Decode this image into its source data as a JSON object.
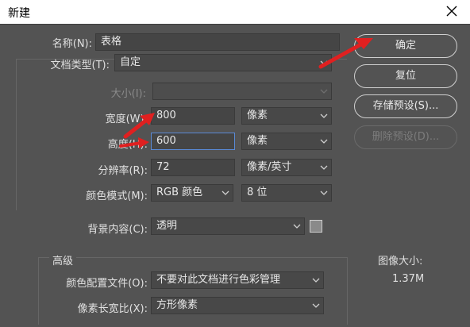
{
  "window": {
    "title": "新建"
  },
  "form": {
    "name": {
      "label": "名称(N):",
      "value": "表格"
    },
    "doc_type": {
      "label": "文档类型(T):",
      "value": "自定"
    },
    "size": {
      "label": "大小(I):",
      "value": ""
    },
    "width": {
      "label": "宽度(W):",
      "value": "800",
      "unit": "像素"
    },
    "height": {
      "label": "高度(H):",
      "value": "600",
      "unit": "像素"
    },
    "resolution": {
      "label": "分辨率(R):",
      "value": "72",
      "unit": "像素/英寸"
    },
    "color_mode": {
      "label": "颜色模式(M):",
      "mode": "RGB 颜色",
      "depth": "8 位"
    },
    "background": {
      "label": "背景内容(C):",
      "value": "透明"
    }
  },
  "advanced": {
    "title": "高级",
    "color_profile": {
      "label": "颜色配置文件(O):",
      "value": "不要对此文档进行色彩管理"
    },
    "pixel_aspect": {
      "label": "像素长宽比(X):",
      "value": "方形像素"
    }
  },
  "buttons": {
    "ok": "确定",
    "reset": "复位",
    "save_preset": "存储预设(S)...",
    "delete_preset": "删除预设(D)..."
  },
  "image_size": {
    "label": "图像大小:",
    "value": "1.37M"
  },
  "colors": {
    "annotation_arrow": "#e02020",
    "focus_border": "#5a8ad6",
    "panel": "#535353"
  }
}
